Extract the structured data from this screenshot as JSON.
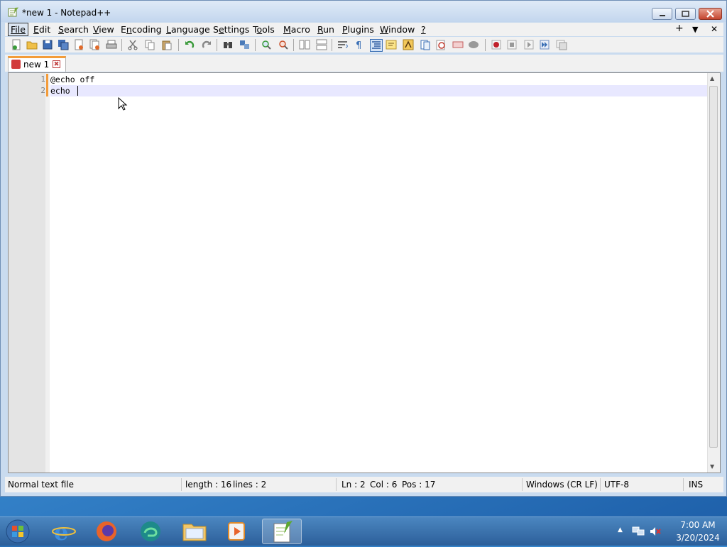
{
  "window": {
    "title": "*new 1 - Notepad++",
    "minimize_label": "–",
    "restore_label": "❐",
    "close_label": "✖"
  },
  "menu": {
    "items": [
      {
        "label": "File",
        "accel_index": 0
      },
      {
        "label": "Edit",
        "accel_index": 0
      },
      {
        "label": "Search",
        "accel_index": 0
      },
      {
        "label": "View",
        "accel_index": 0
      },
      {
        "label": "Encoding",
        "accel_index": 1
      },
      {
        "label": "Language",
        "accel_index": 0
      },
      {
        "label": "Settings",
        "accel_index": 1
      },
      {
        "label": "Tools",
        "accel_index": 1
      },
      {
        "label": "Macro",
        "accel_index": 0
      },
      {
        "label": "Run",
        "accel_index": 0
      },
      {
        "label": "Plugins",
        "accel_index": 0
      },
      {
        "label": "Window",
        "accel_index": 0
      },
      {
        "label": "?",
        "accel_index": 0
      }
    ],
    "right_plus": "+",
    "right_down": "▼",
    "right_close": "✕"
  },
  "toolbar": {
    "icons": [
      "new-file",
      "open-file",
      "save",
      "save-all",
      "close",
      "close-all",
      "print",
      "cut",
      "copy",
      "paste",
      "undo",
      "redo",
      "find",
      "replace",
      "zoom-in",
      "zoom-out",
      "sync-v",
      "sync-h",
      "word-wrap",
      "show-all-chars",
      "indent-guide",
      "udl",
      "doc-map",
      "function-list",
      "folder-as-workspace",
      "monitoring",
      "record-macro",
      "stop-record",
      "play-macro",
      "run-macro-multiple",
      "save-macro"
    ]
  },
  "tabs": [
    {
      "label": "new 1",
      "active": true,
      "close_label": "✖"
    }
  ],
  "editor": {
    "lines": [
      {
        "number": "1",
        "text": "@echo off"
      },
      {
        "number": "2",
        "text": "echo "
      }
    ],
    "current_line": 2
  },
  "status": {
    "file_type": "Normal text file",
    "length": "length : 16",
    "lines": "lines : 2",
    "ln": "Ln : 2",
    "col": "Col : 6",
    "pos": "Pos : 17",
    "eol": "Windows (CR LF)",
    "encoding": "UTF-8",
    "mode": "INS"
  },
  "taskbar": {
    "apps": [
      "start-orb",
      "internet-explorer",
      "firefox",
      "edge",
      "file-explorer",
      "media-player",
      "notepad-plus-plus"
    ],
    "active_app": "notepad-plus-plus",
    "time": "7:00 AM",
    "date": "3/20/2024",
    "tray_expand": "▲"
  },
  "colors": {
    "accent_tab": "#f39c3a",
    "current_line": "#e8e8ff",
    "close_button": "#c4452e"
  }
}
